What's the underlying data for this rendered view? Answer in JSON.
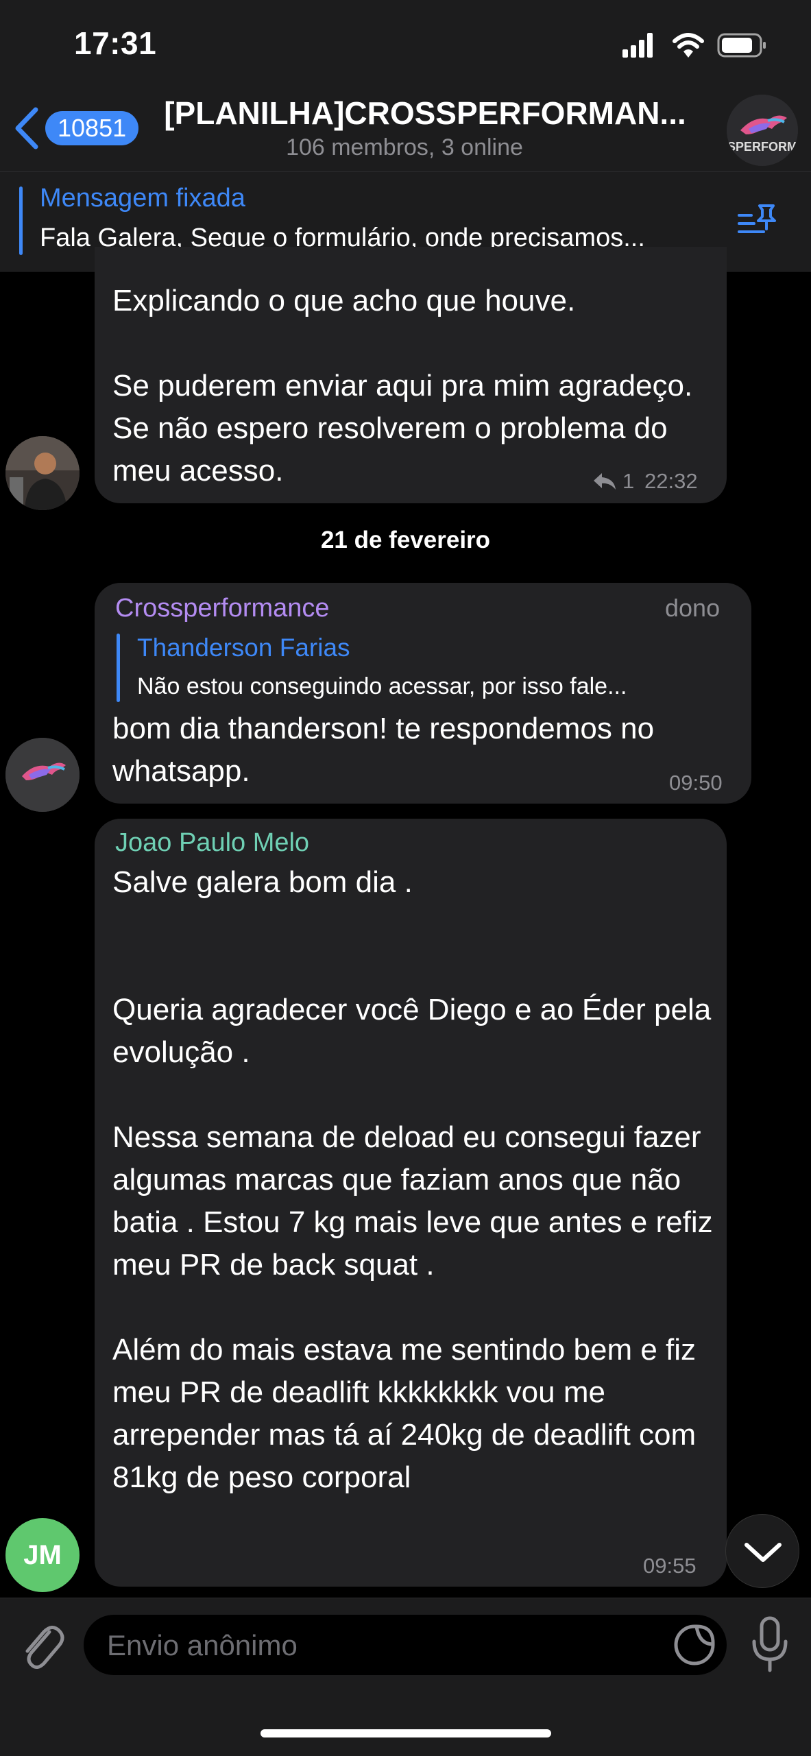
{
  "status_bar": {
    "time": "17:31"
  },
  "header": {
    "back_badge": "10851",
    "title": "[PLANILHA]CROSSPERFORMAN...",
    "subtitle": "106 membros, 3 online",
    "avatar_text": "SPERFORM"
  },
  "pinned": {
    "title": "Mensagem fixada",
    "text": "Fala Galera, Segue o formulário, onde precisamos..."
  },
  "messages": [
    {
      "text": "Explicando o que acho que houve.\n\nSe puderem enviar aqui pra mim agradeço. Se não espero resolverem o problema do meu acesso.",
      "reply_count": "1",
      "time": "22:32"
    },
    {
      "sender": "Crossperformance",
      "role": "dono",
      "quote_author": "Thanderson Farias",
      "quote_text": "Não estou conseguindo acessar, por isso fale...",
      "text": "bom dia thanderson! te respondemos no whatsapp.",
      "time": "09:50"
    },
    {
      "sender": "Joao Paulo Melo",
      "text": "Salve galera bom dia .\n\n\nQueria agradecer você Diego e ao Éder pela evolução .\n\nNessa semana de deload eu consegui fazer algumas marcas que faziam anos que não batia . Estou 7 kg mais leve que antes e refiz meu PR de back squat .\n\nAlém do mais estava me sentindo bem e fiz meu PR de deadlift kkkkkkkk vou me arrepender mas tá aí 240kg de deadlift com 81kg de peso corporal",
      "time": "09:55",
      "avatar_initials": "JM"
    }
  ],
  "date_separator": "21 de fevereiro",
  "input": {
    "placeholder": "Envio anônimo"
  },
  "colors": {
    "accent": "#3e88f7",
    "crossperformance_name": "#b48cf2",
    "joao_name": "#6fd0b4",
    "avatar_green": "#5fc86e"
  }
}
